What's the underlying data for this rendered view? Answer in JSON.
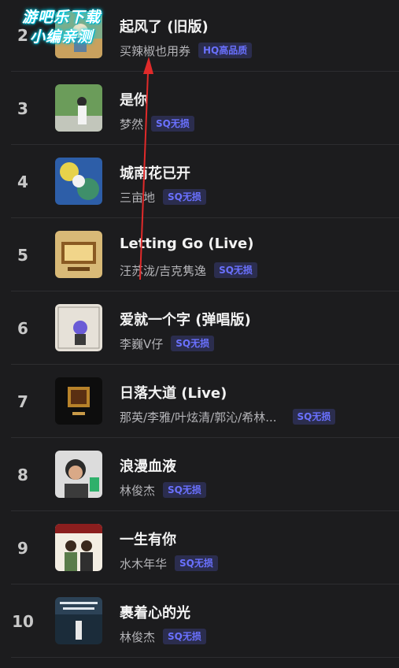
{
  "watermark": {
    "line1": "游吧乐下载",
    "line2": "小编亲测"
  },
  "songs": [
    {
      "rank": "2",
      "title": "起风了 (旧版)",
      "artist": "买辣椒也用券",
      "quality": "HQ高品质"
    },
    {
      "rank": "3",
      "title": "是你",
      "artist": "梦然",
      "quality": "SQ无损"
    },
    {
      "rank": "4",
      "title": "城南花已开",
      "artist": "三亩地",
      "quality": "SQ无损"
    },
    {
      "rank": "5",
      "title": "Letting Go (Live)",
      "artist": "汪苏泷/吉克隽逸",
      "quality": "SQ无损"
    },
    {
      "rank": "6",
      "title": "爱就一个字 (弹唱版)",
      "artist": "李巍V仔",
      "quality": "SQ无损"
    },
    {
      "rank": "7",
      "title": "日落大道 (Live)",
      "artist": "那英/李雅/叶炫清/郭沁/希林...",
      "quality": "SQ无损"
    },
    {
      "rank": "8",
      "title": "浪漫血液",
      "artist": "林俊杰",
      "quality": "SQ无损"
    },
    {
      "rank": "9",
      "title": "一生有你",
      "artist": "水木年华",
      "quality": "SQ无损"
    },
    {
      "rank": "10",
      "title": "裹着心的光",
      "artist": "林俊杰",
      "quality": "SQ无损"
    }
  ],
  "colors": {
    "background": "#1c1c1e",
    "badge_text": "#6a71ff",
    "badge_bg": "#2b2d4e",
    "annotation_arrow": "#e02a2a"
  }
}
